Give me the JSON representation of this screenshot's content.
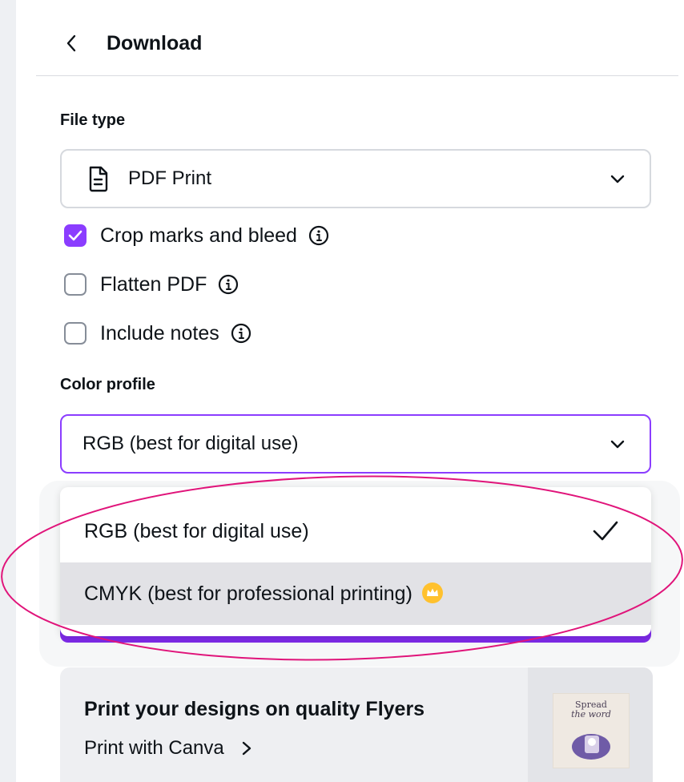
{
  "header": {
    "title": "Download"
  },
  "file_type": {
    "label": "File type",
    "selected": "PDF Print"
  },
  "options": {
    "crop_marks": {
      "label": "Crop marks and bleed",
      "checked": true
    },
    "flatten_pdf": {
      "label": "Flatten PDF",
      "checked": false
    },
    "include_notes": {
      "label": "Include notes",
      "checked": false
    }
  },
  "color_profile": {
    "label": "Color profile",
    "selected": "RGB (best for digital use)",
    "menu": [
      {
        "label": "RGB (best for digital use)",
        "selected": true
      },
      {
        "label": "CMYK (best for professional printing)",
        "premium": true
      }
    ]
  },
  "print_promo": {
    "title": "Print your designs on quality Flyers",
    "link": "Print with Canva",
    "thumbnail_text": [
      "Spread",
      "the word"
    ]
  },
  "colors": {
    "accent": "#8b3dff",
    "annotation": "#e0147a",
    "premium": "#ffc12e"
  }
}
